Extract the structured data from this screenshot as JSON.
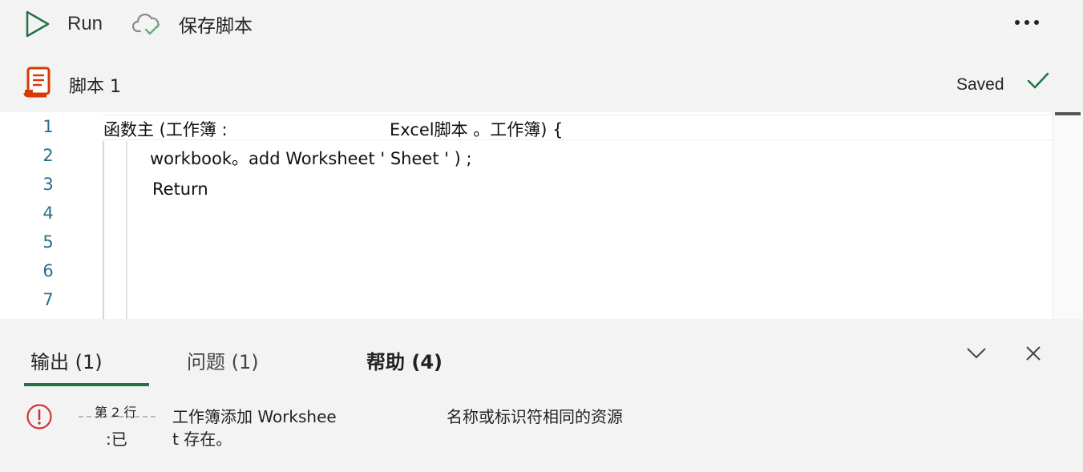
{
  "toolbar": {
    "run_label": "Run",
    "save_label": "保存脚本",
    "more_icon": "more-horizontal-icon"
  },
  "script": {
    "name": "脚本 1",
    "status": "Saved"
  },
  "editor": {
    "line_numbers": [
      "1",
      "2",
      "3",
      "4",
      "5",
      "6",
      "7"
    ],
    "lines": {
      "l1_a": "函数主 (工作簿 :",
      "l1_b": "Excel脚本 。工作簿) {",
      "l2": "workbook。add Worksheet ' Sheet ' ) ;",
      "l3": "Return"
    }
  },
  "panel": {
    "tabs": [
      {
        "label": "输出 (1)"
      },
      {
        "label": "问题 (1)"
      },
      {
        "label": "帮助 (4)"
      }
    ],
    "error": {
      "line_label": "第 2 行",
      "prefix": ":已",
      "message_part1": "工作簿添加 Workshee",
      "message_part2": "t 存在。",
      "message_part3": "名称或标识符相同的资源"
    }
  },
  "colors": {
    "accent_green": "#217346",
    "error_red": "#d13438",
    "line_number": "#2b6f8a",
    "script_orange": "#d83b01"
  }
}
